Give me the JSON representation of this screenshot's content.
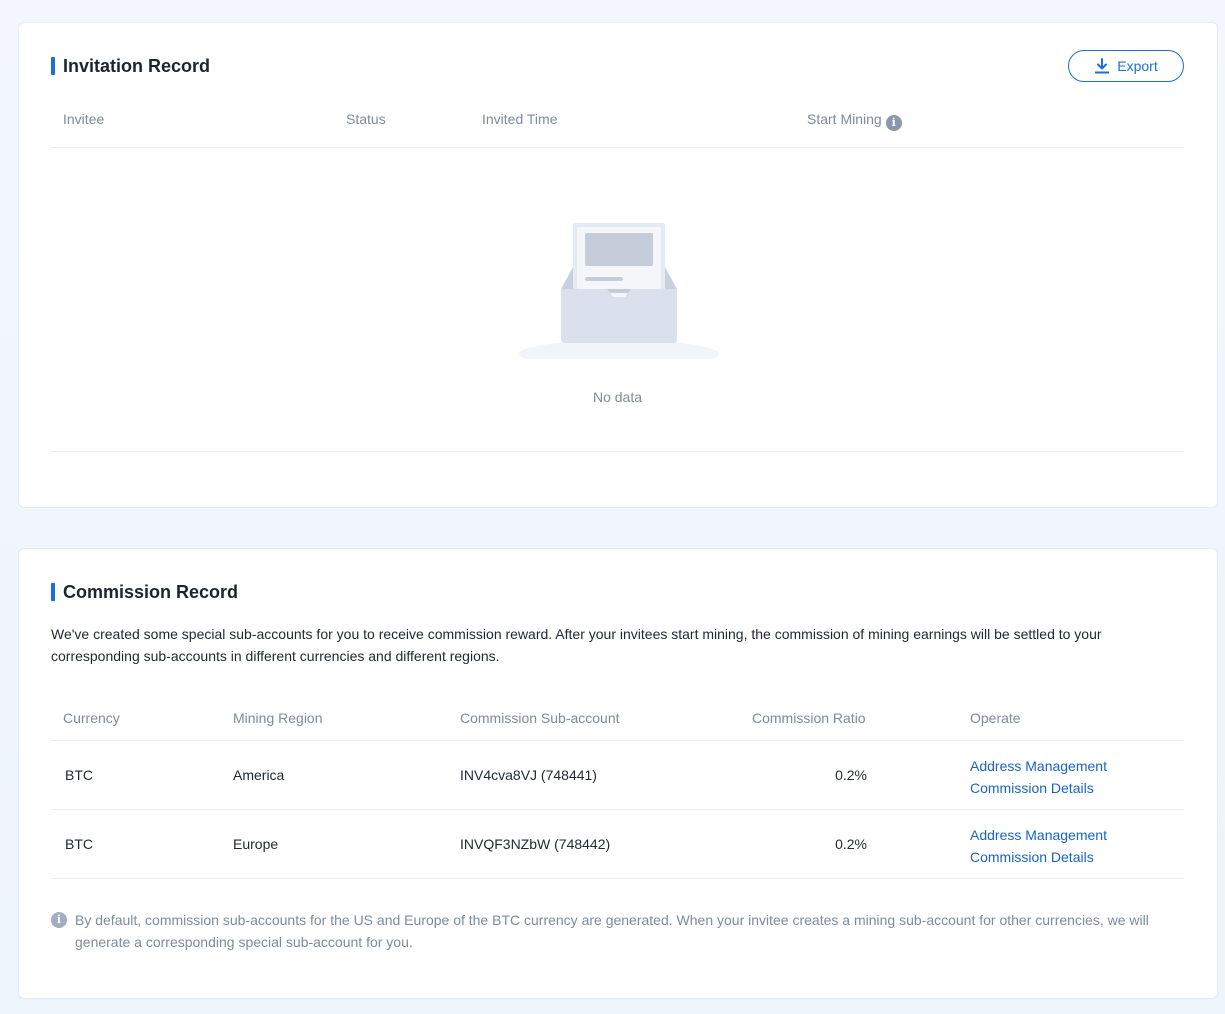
{
  "invitation": {
    "title": "Invitation Record",
    "export_label": "Export",
    "columns": {
      "invitee": "Invitee",
      "status": "Status",
      "invited_time": "Invited Time",
      "start_mining": "Start Mining"
    },
    "empty_text": "No data"
  },
  "commission": {
    "title": "Commission Record",
    "description": "We've created some special sub-accounts for you to receive commission reward. After your invitees start mining, the commission of mining earnings will be settled to your corresponding sub-accounts in different currencies and different regions.",
    "columns": {
      "currency": "Currency",
      "mining_region": "Mining Region",
      "sub_account": "Commission Sub-account",
      "ratio": "Commission Ratio",
      "operate": "Operate"
    },
    "rows": [
      {
        "currency": "BTC",
        "region": "America",
        "sub_account": "INV4cva8VJ (748441)",
        "ratio": "0.2%",
        "op_address": "Address Management",
        "op_details": "Commission Details"
      },
      {
        "currency": "BTC",
        "region": "Europe",
        "sub_account": "INVQF3NZbW (748442)",
        "ratio": "0.2%",
        "op_address": "Address Management",
        "op_details": "Commission Details"
      }
    ],
    "note": "By default, commission sub-accounts for the US and Europe of the BTC currency are generated. When your invitee creates a mining sub-account for other currencies, we will generate a corresponding special sub-account for you."
  },
  "icons": {
    "export": "download-icon",
    "info": "info-circle-icon",
    "empty": "empty-inbox-icon"
  },
  "colors": {
    "accent": "#1a6fdb",
    "link": "#1565c8",
    "muted_text": "#7d8b9e",
    "border": "#e9eef5"
  }
}
